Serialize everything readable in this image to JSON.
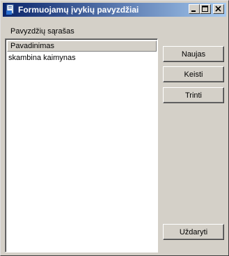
{
  "window": {
    "title": "Formuojamų įvykių pavyzdžiai"
  },
  "list": {
    "label": "Pavyzdžių sąrašas",
    "column_header": "Pavadinimas",
    "rows": [
      "skambina kaimynas"
    ]
  },
  "buttons": {
    "new": "Naujas",
    "edit": "Keisti",
    "delete": "Trinti",
    "close": "Uždaryti"
  },
  "colors": {
    "title_start": "#0a246a",
    "title_end": "#a6caf0",
    "face": "#d4d0c8"
  }
}
